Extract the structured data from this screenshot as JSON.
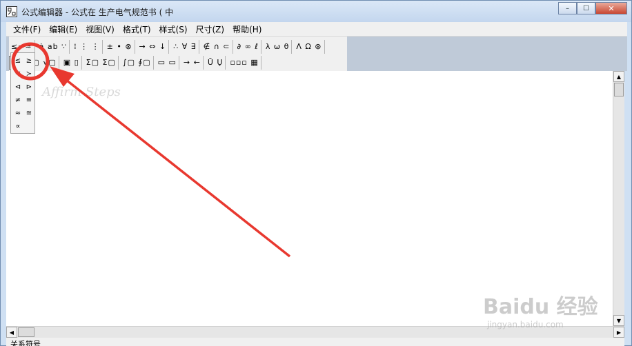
{
  "window": {
    "title": "公式编辑器 - 公式在 生产电气规范书 ( 中",
    "controls": {
      "minimize": "–",
      "maximize": "☐",
      "close": "✕"
    }
  },
  "menu": [
    "文件(F)",
    "编辑(E)",
    "视图(V)",
    "格式(T)",
    "样式(S)",
    "尺寸(Z)",
    "帮助(H)"
  ],
  "toolbar": {
    "row1": [
      "≤≠≈",
      "ȧ ab ∵",
      "⁞ ⋮ ⋮",
      "± • ⊗",
      "→ ⇔ ↓",
      "∴ ∀ ∃",
      "∉ ∩ ⊂",
      "∂ ∞ ℓ",
      "λ ω θ",
      "Λ Ω ⊛"
    ],
    "row2": [
      "≥ |",
      "▢ √▢",
      "▣ ▯",
      "Σ▢ Σ▢",
      "∫▢ ∮▢",
      "▭ ▭",
      "→ ←",
      "Ū Ų",
      "▫▫▫ ▦"
    ]
  },
  "palette": [
    "≤",
    "≥",
    "≺",
    "≻",
    "⊲",
    "⊳",
    "≠",
    "≡",
    "≈",
    "≅",
    "∝"
  ],
  "document": {
    "watermark_text": "Affirm Steps"
  },
  "status": "关系符号",
  "branding": {
    "main": "Baidu 经验",
    "sub": "jingyan.baidu.com"
  },
  "annotation_color": "#e8382f"
}
